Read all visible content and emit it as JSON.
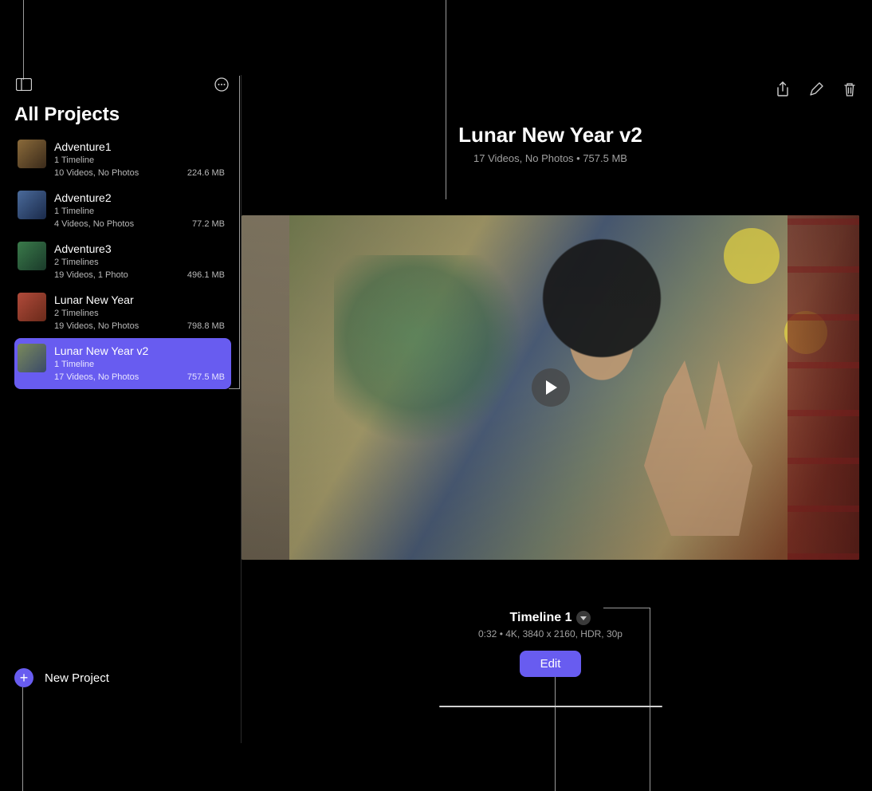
{
  "sidebar": {
    "title": "All Projects",
    "projects": [
      {
        "name": "Adventure1",
        "timelines": "1 Timeline",
        "media": "10 Videos, No Photos",
        "size": "224.6 MB",
        "thumb": "linear-gradient(135deg,#8a6a3a,#3a2a1a)"
      },
      {
        "name": "Adventure2",
        "timelines": "1 Timeline",
        "media": "4 Videos, No Photos",
        "size": "77.2 MB",
        "thumb": "linear-gradient(135deg,#4a6a9a,#1a2a4a)"
      },
      {
        "name": "Adventure3",
        "timelines": "2 Timelines",
        "media": "19 Videos, 1 Photo",
        "size": "496.1 MB",
        "thumb": "linear-gradient(135deg,#3a7a4a,#1a3a2a)"
      },
      {
        "name": "Lunar New Year",
        "timelines": "2 Timelines",
        "media": "19 Videos, No Photos",
        "size": "798.8 MB",
        "thumb": "linear-gradient(135deg,#b04a3a,#6a2a1a)"
      },
      {
        "name": "Lunar New Year v2",
        "timelines": "1 Timeline",
        "media": "17 Videos, No Photos",
        "size": "757.5 MB",
        "thumb": "linear-gradient(135deg,#7a8a5a,#3a4a6a)",
        "selected": true
      }
    ],
    "newProjectLabel": "New Project"
  },
  "main": {
    "title": "Lunar New Year v2",
    "subtitle": "17 Videos, No Photos • 757.5 MB",
    "timeline": {
      "title": "Timeline 1",
      "subtitle": "0:32 • 4K, 3840 x 2160, HDR, 30p",
      "editLabel": "Edit"
    }
  }
}
